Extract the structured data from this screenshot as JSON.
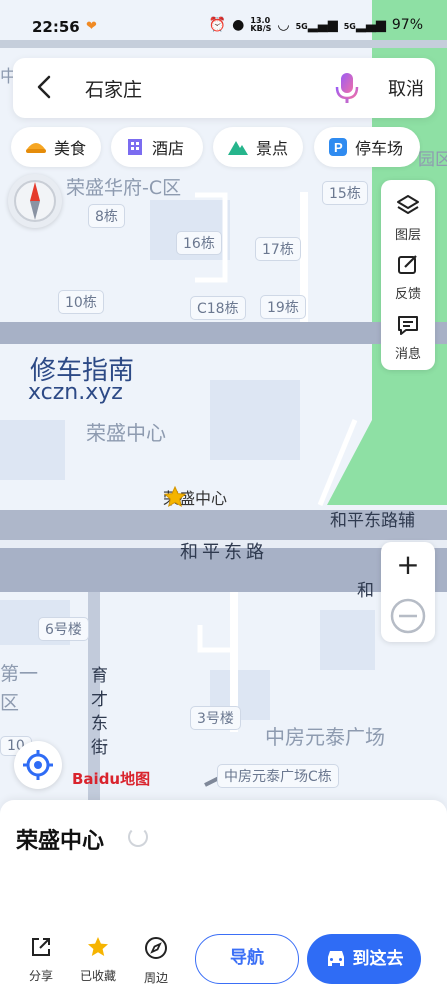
{
  "status_bar": {
    "time": "22:56",
    "net_speed": "13.0\nKB/S",
    "net_speed_line1": "13.0",
    "net_speed_line2": "KB/S",
    "signal1": "5G",
    "signal2": "5G",
    "battery": "97%"
  },
  "search": {
    "query": "石家庄",
    "cancel_label": "取消"
  },
  "chips": [
    {
      "label": "美食",
      "icon": "food-icon"
    },
    {
      "label": "酒店",
      "icon": "hotel-icon"
    },
    {
      "label": "景点",
      "icon": "scenic-icon"
    },
    {
      "label": "停车场",
      "icon": "parking-icon"
    }
  ],
  "side_panel": {
    "layers": "图层",
    "feedback": "反馈",
    "messages": "消息"
  },
  "map": {
    "labels": {
      "district_top": "荣盛华府-C区",
      "building_8": "8栋",
      "building_15": "15栋",
      "building_16": "16栋",
      "building_17": "17栋",
      "building_10": "10栋",
      "building_c18": "C18栋",
      "building_19": "19栋",
      "watermark_cn": "修车指南",
      "watermark_en": "xczn.xyz",
      "area_name": "荣盛中心",
      "poi_name": "荣盛中心",
      "road_aux": "和平东路辅",
      "road_main": "和平东路",
      "road_side": "和",
      "building_6": "6号楼",
      "district_left_1": "第一",
      "district_left_2": "区",
      "street_v": "育才东街",
      "building_3": "3号楼",
      "plaza": "中房元泰广场",
      "plaza_c": "中房元泰广场C栋",
      "building_10_left": "10",
      "edge_left_top": "中",
      "edge_right_top": "园区"
    },
    "logo": "Baidu地图",
    "accent_color": "#2f6cf5",
    "park_color": "#8ee0a4"
  },
  "place_sheet": {
    "title": "荣盛中心"
  },
  "bottom_bar": {
    "share": "分享",
    "saved": "已收藏",
    "nearby": "周边",
    "navigate": "导航",
    "go_here": "到这去"
  }
}
